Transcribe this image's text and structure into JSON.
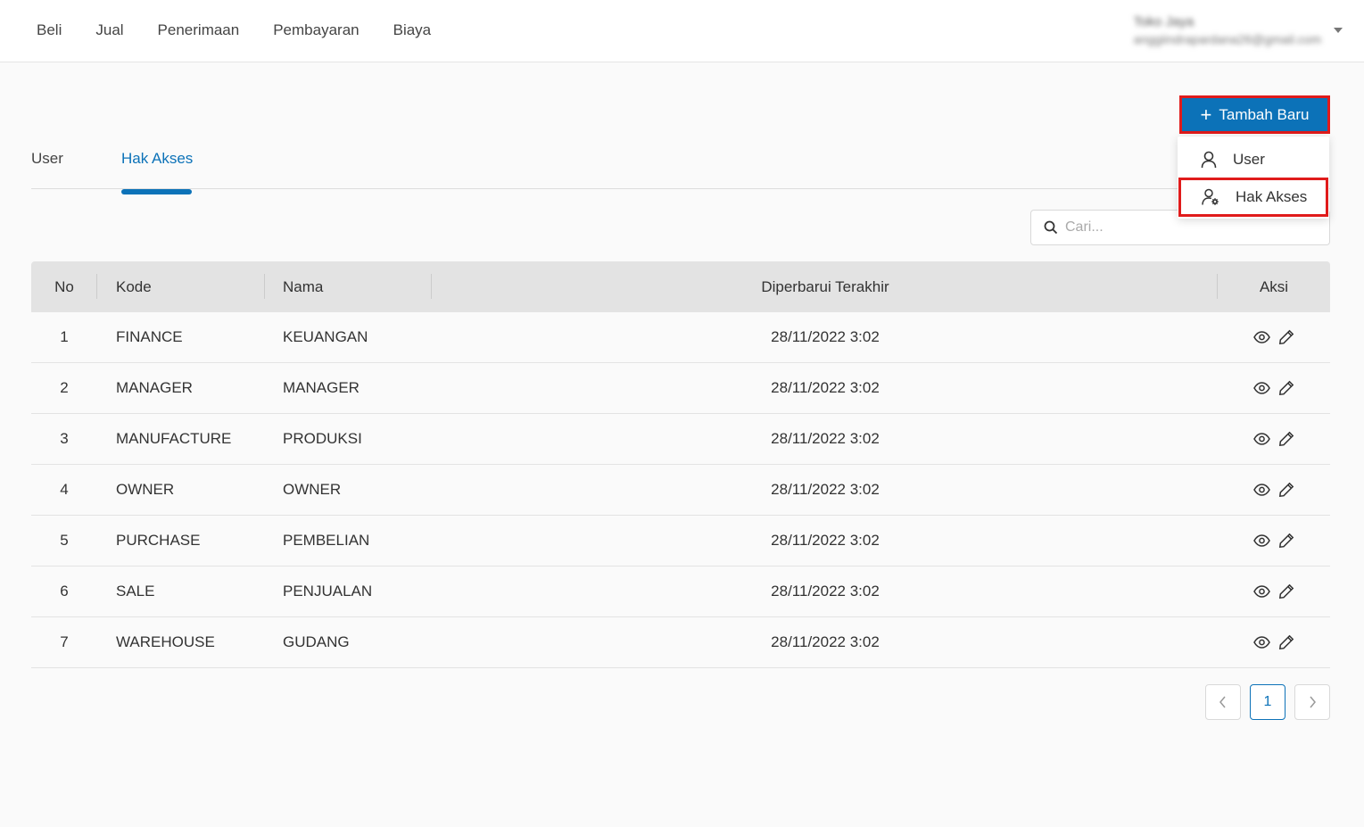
{
  "topnav": {
    "menu": [
      "Beli",
      "Jual",
      "Penerimaan",
      "Pembayaran",
      "Biaya"
    ],
    "account_name": "Toko Jaya",
    "account_email": "anggiindrapardana26@gmail.com"
  },
  "add_button": {
    "label": "Tambah Baru"
  },
  "dropdown": {
    "items": [
      "User",
      "Hak Akses"
    ]
  },
  "tabs": {
    "items": [
      "User",
      "Hak Akses"
    ],
    "active": "Hak Akses"
  },
  "search": {
    "placeholder": "Cari..."
  },
  "table": {
    "columns": [
      "No",
      "Kode",
      "Nama",
      "Diperbarui Terakhir",
      "Aksi"
    ],
    "rows": [
      {
        "no": "1",
        "kode": "FINANCE",
        "nama": "KEUANGAN",
        "updated": "28/11/2022 3:02"
      },
      {
        "no": "2",
        "kode": "MANAGER",
        "nama": "MANAGER",
        "updated": "28/11/2022 3:02"
      },
      {
        "no": "3",
        "kode": "MANUFACTURE",
        "nama": "PRODUKSI",
        "updated": "28/11/2022 3:02"
      },
      {
        "no": "4",
        "kode": "OWNER",
        "nama": "OWNER",
        "updated": "28/11/2022 3:02"
      },
      {
        "no": "5",
        "kode": "PURCHASE",
        "nama": "PEMBELIAN",
        "updated": "28/11/2022 3:02"
      },
      {
        "no": "6",
        "kode": "SALE",
        "nama": "PENJUALAN",
        "updated": "28/11/2022 3:02"
      },
      {
        "no": "7",
        "kode": "WAREHOUSE",
        "nama": "GUDANG",
        "updated": "28/11/2022 3:02"
      }
    ]
  },
  "pagination": {
    "current_page": "1",
    "prev_icon": "chevron-left-icon",
    "next_icon": "chevron-right-icon"
  },
  "icons": {
    "view": "eye-icon",
    "edit": "pencil-icon",
    "add": "plus-icon",
    "user": "user-icon",
    "user_settings": "user-gear-icon",
    "search": "search-icon"
  },
  "colors": {
    "primary": "#0c72b8",
    "highlight": "#e01b1b",
    "table_header": "#e3e3e3"
  }
}
